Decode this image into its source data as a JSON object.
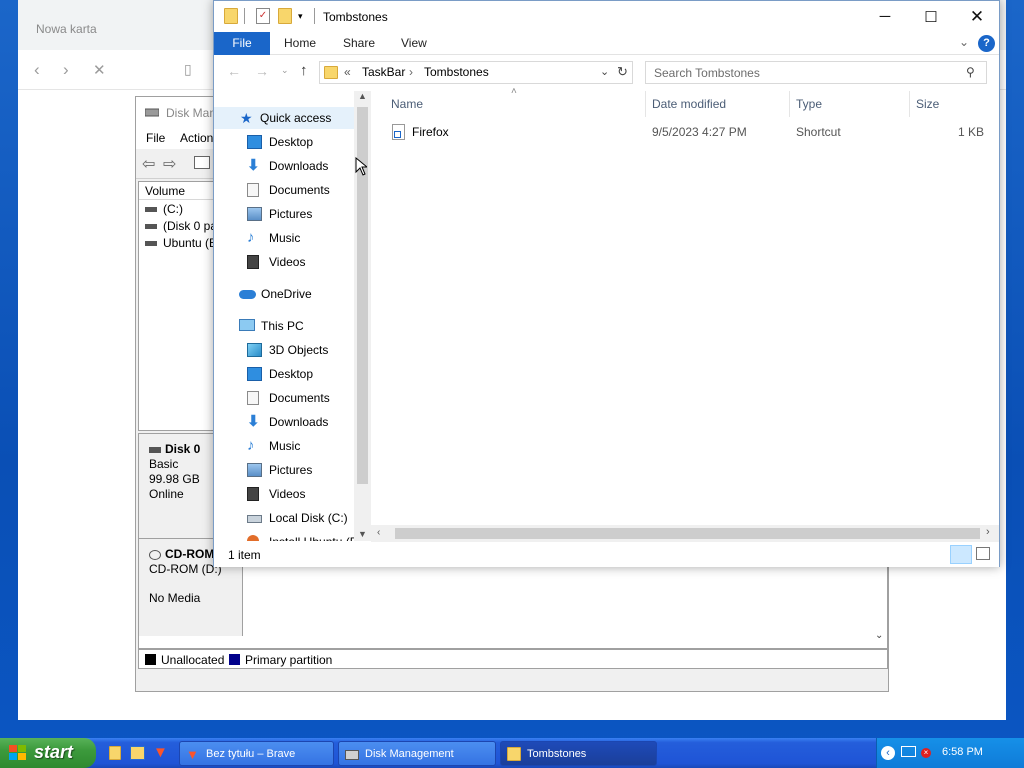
{
  "browser": {
    "tab_title": "Nowa karta"
  },
  "disk_management": {
    "title": "Disk Man",
    "menu": [
      "File",
      "Action"
    ],
    "volume_header": "Volume",
    "volumes": [
      "(C:)",
      "(Disk 0 par",
      "Ubuntu (E:"
    ],
    "disk0": {
      "name": "Disk 0",
      "type": "Basic",
      "size": "99.98 GB",
      "status": "Online"
    },
    "cdrom": {
      "name": "CD-ROM",
      "drive": "CD-ROM (D:)",
      "media": "No Media"
    },
    "legend": [
      {
        "label": "Unallocated",
        "color": "#000000"
      },
      {
        "label": "Primary partition",
        "color": "#00008b"
      }
    ]
  },
  "explorer": {
    "title": "Tombstones",
    "ribbon_tabs": [
      "File",
      "Home",
      "Share",
      "View"
    ],
    "help_label": "?",
    "address": {
      "prefix": "«",
      "parts": [
        "TaskBar",
        "Tombstones"
      ]
    },
    "search_placeholder": "Search Tombstones",
    "nav": {
      "quick_access": "Quick access",
      "quick_items": [
        "Desktop",
        "Downloads",
        "Documents",
        "Pictures",
        "Music",
        "Videos"
      ],
      "onedrive": "OneDrive",
      "this_pc": "This PC",
      "pc_items": [
        "3D Objects",
        "Desktop",
        "Documents",
        "Downloads",
        "Music",
        "Pictures",
        "Videos",
        "Local Disk (C:)",
        "Install Ubuntu (E"
      ]
    },
    "columns": {
      "name": "Name",
      "date": "Date modified",
      "type": "Type",
      "size": "Size"
    },
    "files": [
      {
        "name": "Firefox",
        "date": "9/5/2023 4:27 PM",
        "type": "Shortcut",
        "size": "1 KB"
      }
    ],
    "status": "1 item"
  },
  "taskbar": {
    "start_label": "start",
    "buttons": [
      "Bez tytułu – Brave",
      "Disk Management",
      "Tombstones"
    ],
    "clock": "6:58 PM"
  },
  "colors": {
    "accent": "#1a66c9",
    "taskbar": "#245edb",
    "start": "#3c9a3c",
    "desktop": "#0a4fb5"
  }
}
